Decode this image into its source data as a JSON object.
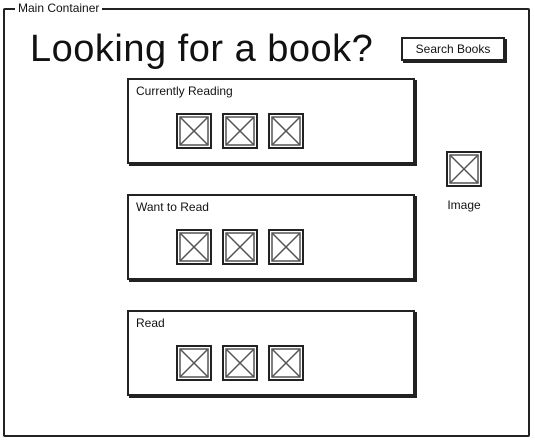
{
  "container": {
    "label": "Main Container"
  },
  "header": {
    "headline": "Looking for a book?",
    "search_button": "Search Books"
  },
  "shelves": [
    {
      "title": "Currently Reading",
      "covers": [
        "book-cover-placeholder",
        "book-cover-placeholder",
        "book-cover-placeholder"
      ]
    },
    {
      "title": "Want to Read",
      "covers": [
        "book-cover-placeholder",
        "book-cover-placeholder",
        "book-cover-placeholder"
      ]
    },
    {
      "title": "Read",
      "covers": [
        "book-cover-placeholder",
        "book-cover-placeholder",
        "book-cover-placeholder"
      ]
    }
  ],
  "side_image": {
    "icon": "image-placeholder-icon",
    "caption": "Image"
  }
}
